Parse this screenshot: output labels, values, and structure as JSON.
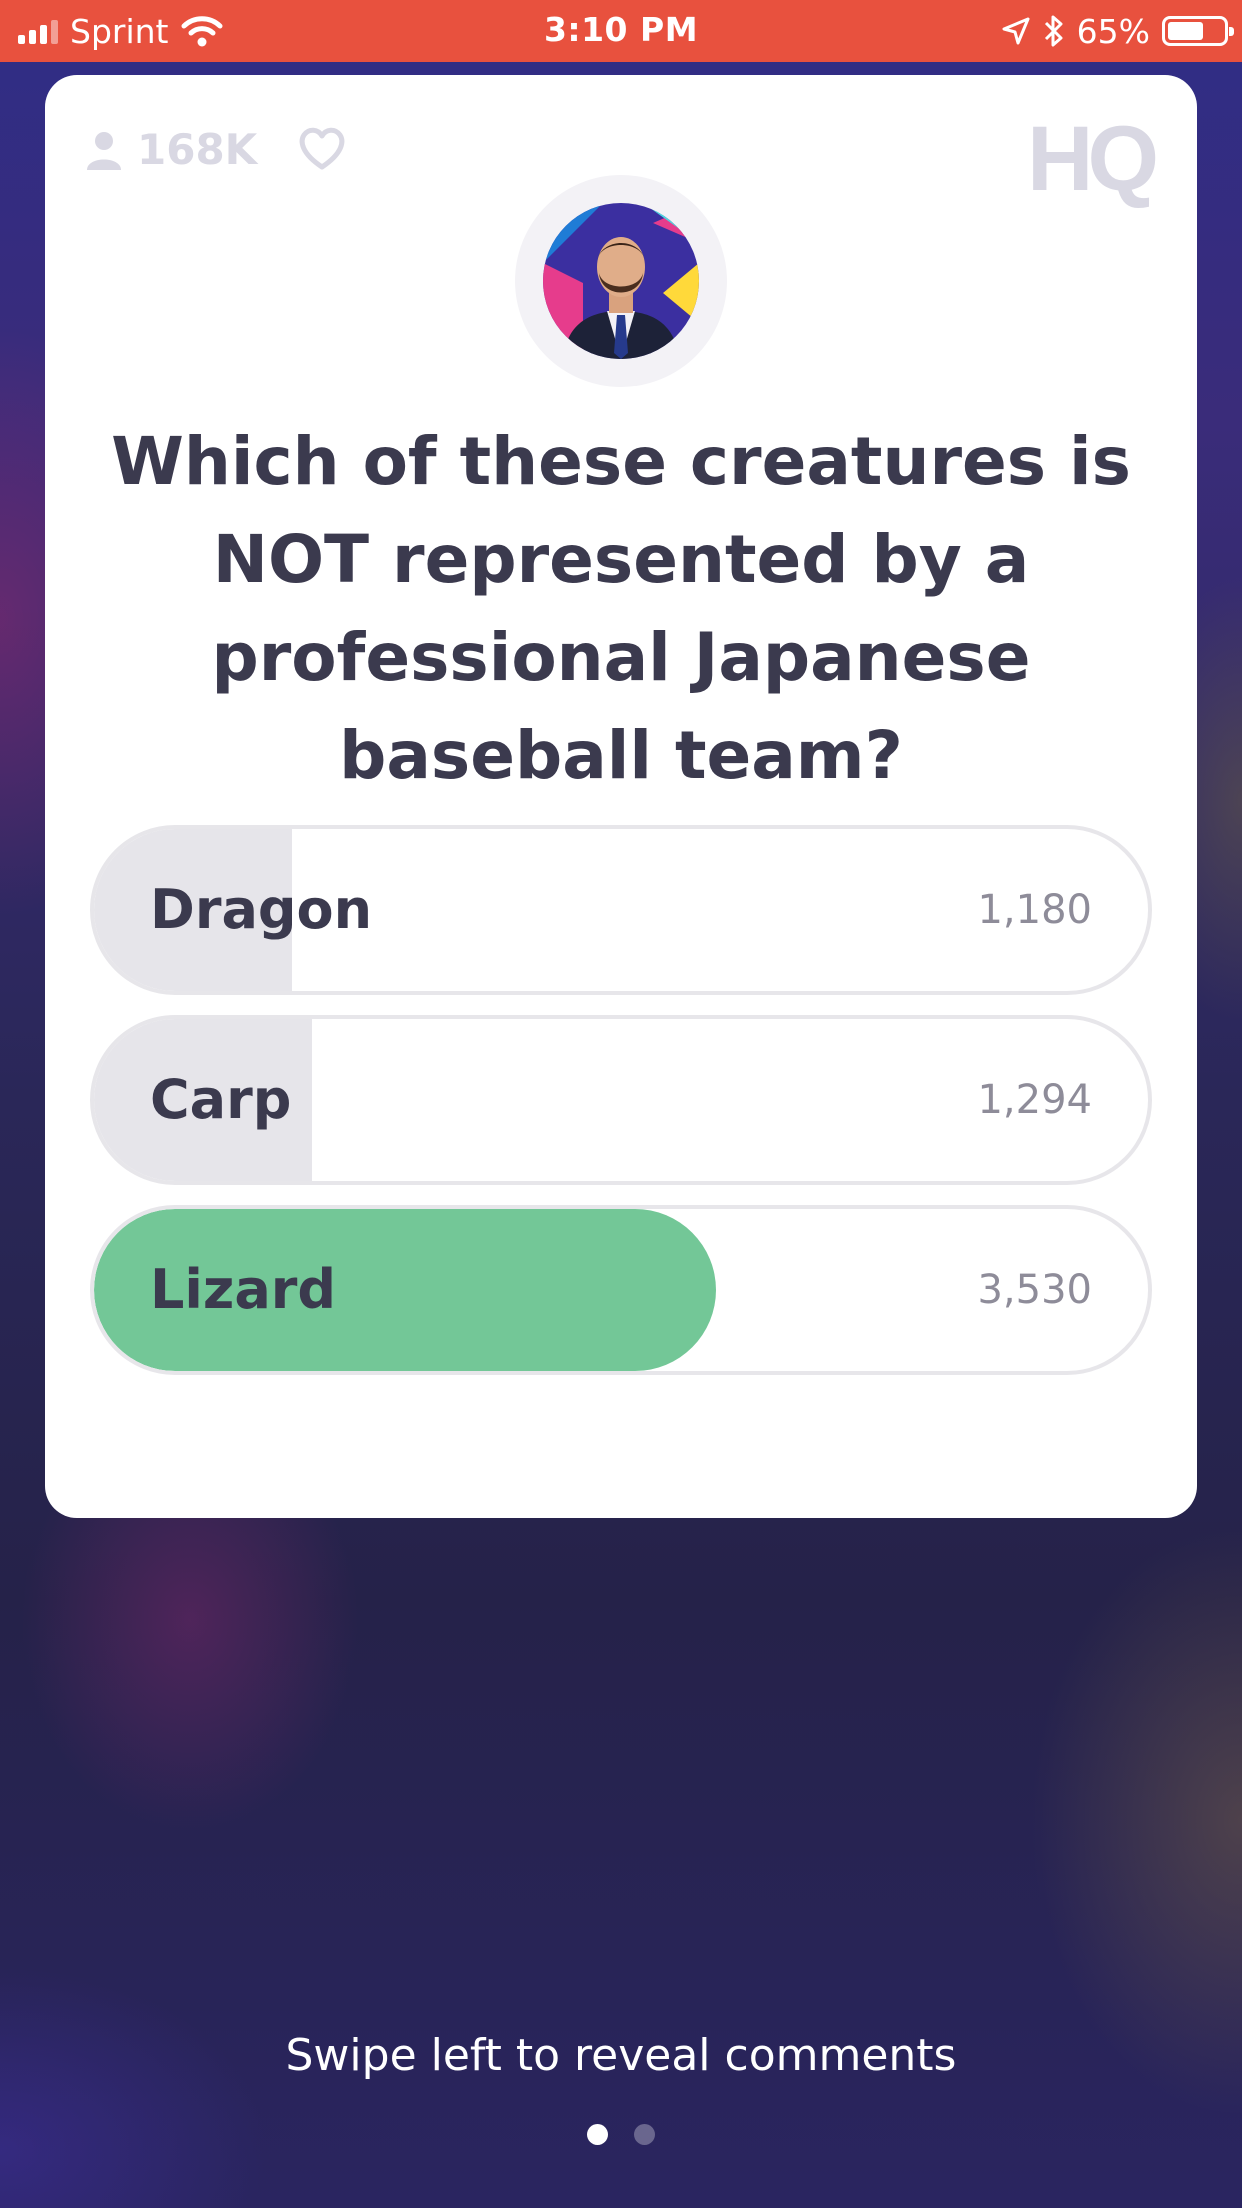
{
  "status_bar": {
    "carrier": "Sprint",
    "time": "3:10 PM",
    "battery_percent": "65%",
    "battery_level": 0.65
  },
  "card": {
    "viewer_count": "168K",
    "logo_text": "HQ",
    "question": "Which of these creatures is NOT represented by a professional Japanese baseball team?",
    "answers": [
      {
        "label": "Dragon",
        "count": "1,180",
        "fill": 0.188,
        "correct": false
      },
      {
        "label": "Carp",
        "count": "1,294",
        "fill": 0.207,
        "correct": false
      },
      {
        "label": "Lizard",
        "count": "3,530",
        "fill": 0.59,
        "correct": true
      }
    ]
  },
  "footer": {
    "swipe_hint": "Swipe left to reveal comments",
    "page_count": 2,
    "active_page": 1
  },
  "colors": {
    "status_bar": "#e8513e",
    "correct": "#73c797",
    "neutral_bar": "#e6e5ea",
    "text_dark": "#3b3a4e"
  }
}
